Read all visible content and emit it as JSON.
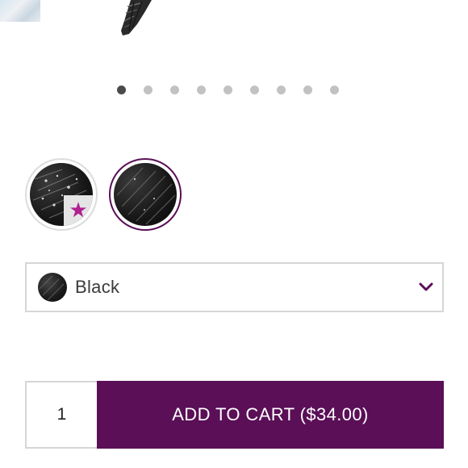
{
  "carousel": {
    "dot_count": 9,
    "active_index": 0
  },
  "swatches": [
    {
      "name": "black-glitter-swatch",
      "badge": "star",
      "selected": false
    },
    {
      "name": "black-swatch",
      "badge": null,
      "selected": true
    }
  ],
  "shade_select": {
    "selected_label": "Black",
    "chevron": "chevron-down-icon"
  },
  "purchase": {
    "quantity": "1",
    "add_to_cart_label": "ADD TO CART ($34.00)"
  },
  "colors": {
    "brand": "#5a0f57",
    "star": "#b0208f",
    "dot_active": "#4a4a4a",
    "dot_inactive": "#c2c2c2",
    "border": "#d6d6d6"
  }
}
